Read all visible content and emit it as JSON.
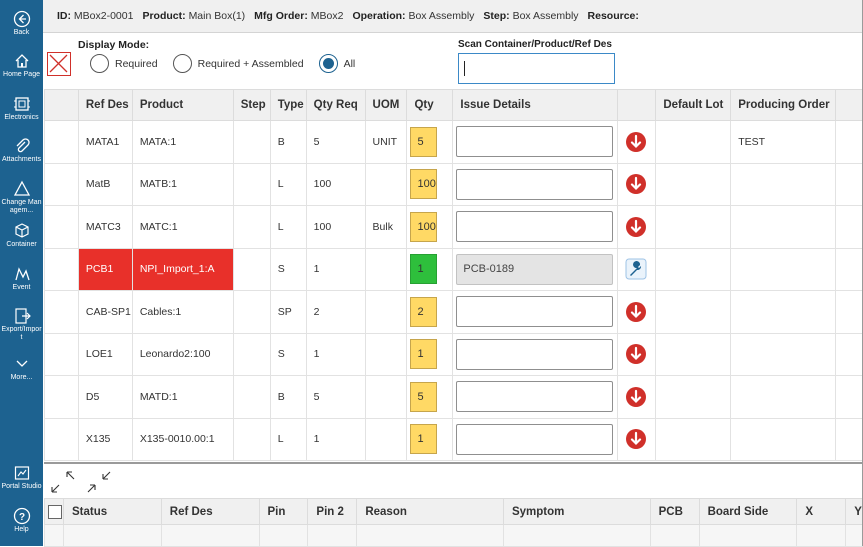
{
  "sidebar": {
    "items": [
      {
        "label": "Back",
        "icon": "back-icon"
      },
      {
        "label": "Home Page",
        "icon": "home-icon"
      },
      {
        "label": "Electronics",
        "icon": "electronics-icon"
      },
      {
        "label": "Attachments",
        "icon": "paperclip-icon"
      },
      {
        "label": "Change Managem...",
        "icon": "change-management-icon"
      },
      {
        "label": "Container",
        "icon": "container-icon"
      },
      {
        "label": "Event",
        "icon": "event-icon"
      },
      {
        "label": "Export/Import",
        "icon": "export-import-icon"
      },
      {
        "label": "More...",
        "icon": "chevron-down-icon"
      },
      {
        "label": "Portal Studio",
        "icon": "portal-studio-icon"
      },
      {
        "label": "Help",
        "icon": "help-icon"
      }
    ]
  },
  "header": {
    "fields": [
      {
        "key": "ID:",
        "value": "MBox2-0001"
      },
      {
        "key": "Product:",
        "value": "Main Box(1)"
      },
      {
        "key": "Mfg Order:",
        "value": "MBox2"
      },
      {
        "key": "Operation:",
        "value": "Box Assembly"
      },
      {
        "key": "Step:",
        "value": "Box Assembly"
      },
      {
        "key": "Resource:",
        "value": ""
      }
    ]
  },
  "display_mode": {
    "title": "Display Mode:",
    "options": [
      "Required",
      "Required + Assembled",
      "All"
    ],
    "selected": "All"
  },
  "scan": {
    "label": "Scan Container/Product/Ref Des",
    "value": "",
    "placeholder": ""
  },
  "main_grid": {
    "columns": [
      "",
      "Ref Des",
      "Product",
      "Step",
      "Type",
      "Qty Req",
      "UOM",
      "Qty",
      "Issue Details",
      "",
      "Default Lot",
      "Producing Order"
    ],
    "rows": [
      {
        "ref_des": "MATA1",
        "product": "MATA:1",
        "step": "",
        "type": "B",
        "qty_req": "5",
        "uom": "UNIT",
        "qty": "5",
        "issue": "",
        "action": "issue-down-icon",
        "default_lot": "",
        "producing_order": "TEST",
        "state": "normal"
      },
      {
        "ref_des": "MatB",
        "product": "MATB:1",
        "step": "",
        "type": "L",
        "qty_req": "100",
        "uom": "",
        "qty": "100",
        "issue": "",
        "action": "issue-down-icon",
        "default_lot": "",
        "producing_order": "",
        "state": "normal"
      },
      {
        "ref_des": "MATC3",
        "product": "MATC:1",
        "step": "",
        "type": "L",
        "qty_req": "100",
        "uom": "Bulk",
        "qty": "100",
        "issue": "",
        "action": "issue-down-icon",
        "default_lot": "",
        "producing_order": "",
        "state": "normal"
      },
      {
        "ref_des": "PCB1",
        "product": "NPI_Import_1:A",
        "step": "",
        "type": "S",
        "qty_req": "1",
        "uom": "",
        "qty": "1",
        "issue": "PCB-0189",
        "action": "wrench-icon",
        "default_lot": "",
        "producing_order": "",
        "state": "issued"
      },
      {
        "ref_des": "CAB-SP1",
        "product": "Cables:1",
        "step": "",
        "type": "SP",
        "qty_req": "2",
        "uom": "",
        "qty": "2",
        "issue": "",
        "action": "issue-down-icon",
        "default_lot": "",
        "producing_order": "",
        "state": "normal"
      },
      {
        "ref_des": "LOE1",
        "product": "Leonardo2:100",
        "step": "",
        "type": "S",
        "qty_req": "1",
        "uom": "",
        "qty": "1",
        "issue": "",
        "action": "issue-down-icon",
        "default_lot": "",
        "producing_order": "",
        "state": "normal"
      },
      {
        "ref_des": "D5",
        "product": "MATD:1",
        "step": "",
        "type": "B",
        "qty_req": "5",
        "uom": "",
        "qty": "5",
        "issue": "",
        "action": "issue-down-icon",
        "default_lot": "",
        "producing_order": "",
        "state": "normal"
      },
      {
        "ref_des": "X135",
        "product": "X135-0010.00:1",
        "step": "",
        "type": "L",
        "qty_req": "1",
        "uom": "",
        "qty": "1",
        "issue": "",
        "action": "issue-down-icon",
        "default_lot": "",
        "producing_order": "",
        "state": "normal"
      }
    ]
  },
  "defect_grid": {
    "columns": [
      "",
      "Status",
      "Ref Des",
      "Pin",
      "Pin 2",
      "Reason",
      "Symptom",
      "PCB",
      "Board Side",
      "X",
      "Y"
    ]
  },
  "colors": {
    "sidebar": "#1d6290",
    "row_highlight": "#e8302a",
    "qty_yellow": "#ffd965",
    "qty_green": "#2ebf3c",
    "action_red": "#d0302a"
  }
}
